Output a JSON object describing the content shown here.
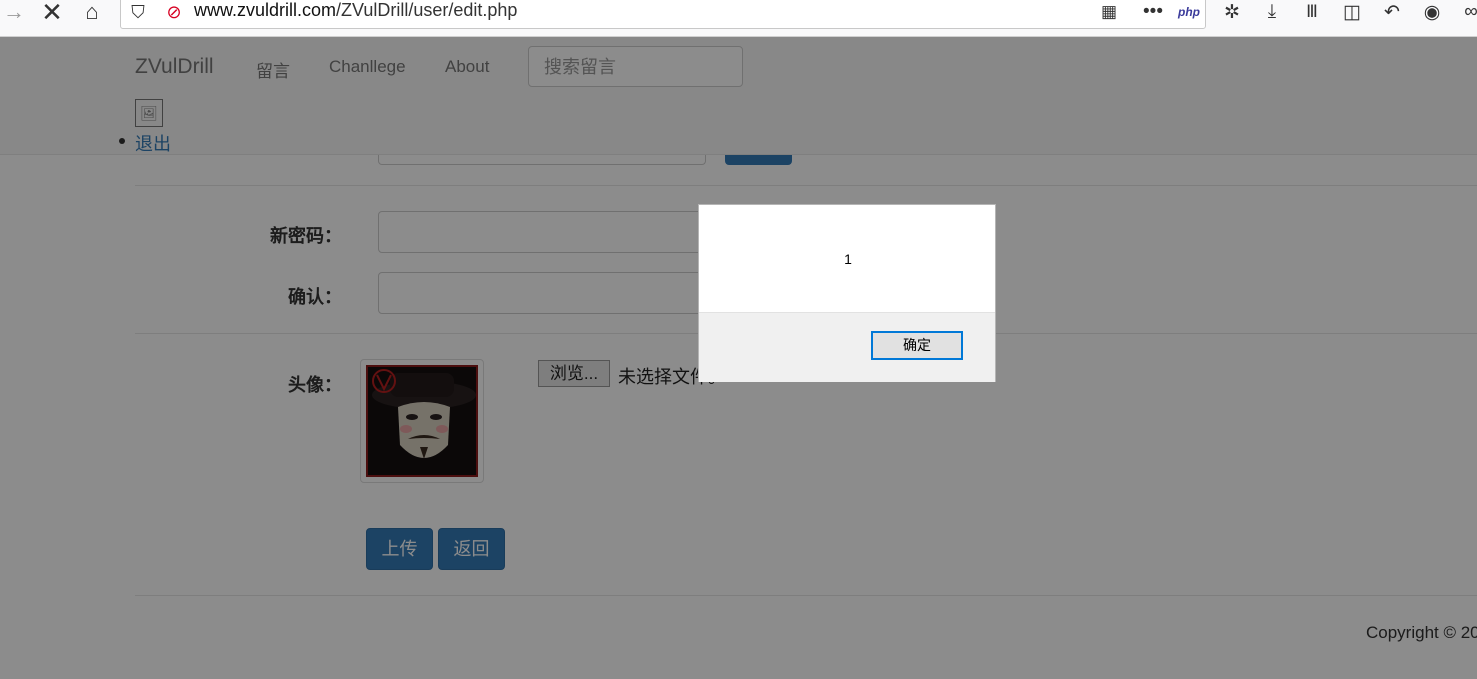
{
  "browser": {
    "url_domain": "www.zvuldrill.com",
    "url_path": "/ZVulDrill/user/edit.php",
    "php_badge": "php",
    "nav_icons": [
      "back-arrow-icon",
      "stop-icon",
      "home-icon",
      "shield-icon",
      "insecure-lock-icon"
    ],
    "toolbar_icons": [
      "qr-code-icon",
      "more-icon",
      "php-icon",
      "settings-icon",
      "download-icon",
      "library-icon",
      "sidebar-icon",
      "undo-icon",
      "account-icon"
    ]
  },
  "navbar": {
    "brand": "ZVulDrill",
    "links": [
      "留言",
      "Chanllege",
      "About"
    ],
    "search_placeholder": "搜索留言",
    "logout": "退出"
  },
  "form": {
    "new_password_label": "新密码：",
    "confirm_label": "确认：",
    "avatar_label": "头像：",
    "browse_button": "浏览...",
    "no_file_text": "未选择文件。",
    "upload_button": "上传",
    "back_button": "返回"
  },
  "footer": {
    "copyright": "Copyright © 20"
  },
  "alert": {
    "message": "1",
    "ok_button": "确定"
  },
  "colors": {
    "primary": "#337ab7",
    "dialog_focus": "#0078d7"
  }
}
